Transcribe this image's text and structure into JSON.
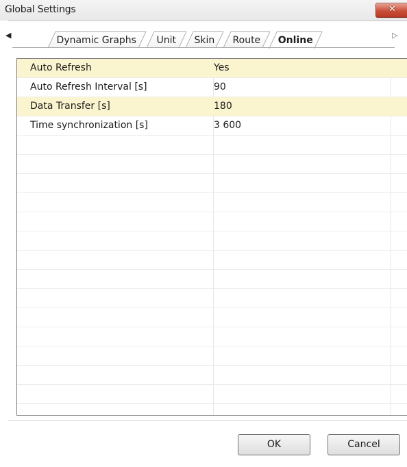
{
  "window": {
    "title": "Global Settings"
  },
  "tabs": {
    "scroll_left_glyph": "◀",
    "scroll_right_glyph": "▷",
    "items": [
      {
        "label": "Dynamic Graphs",
        "active": false
      },
      {
        "label": "Unit",
        "active": false
      },
      {
        "label": "Skin",
        "active": false
      },
      {
        "label": "Route",
        "active": false
      },
      {
        "label": "Online",
        "active": true
      }
    ]
  },
  "grid": {
    "rows": [
      {
        "name": "Auto Refresh",
        "value": "Yes",
        "highlighted": true
      },
      {
        "name": "Auto Refresh Interval [s]",
        "value": "90",
        "highlighted": false
      },
      {
        "name": "Data Transfer [s]",
        "value": "180",
        "highlighted": true
      },
      {
        "name": "Time synchronization [s]",
        "value": "3 600",
        "highlighted": false
      }
    ]
  },
  "buttons": {
    "ok_label": "OK",
    "cancel_label": "Cancel"
  },
  "colors": {
    "highlight_row": "#fbf5cf",
    "close_button": "#c9503a"
  },
  "icons": {
    "close": "close-icon",
    "scroll_left": "triangle-left-icon",
    "scroll_right": "triangle-right-icon"
  }
}
